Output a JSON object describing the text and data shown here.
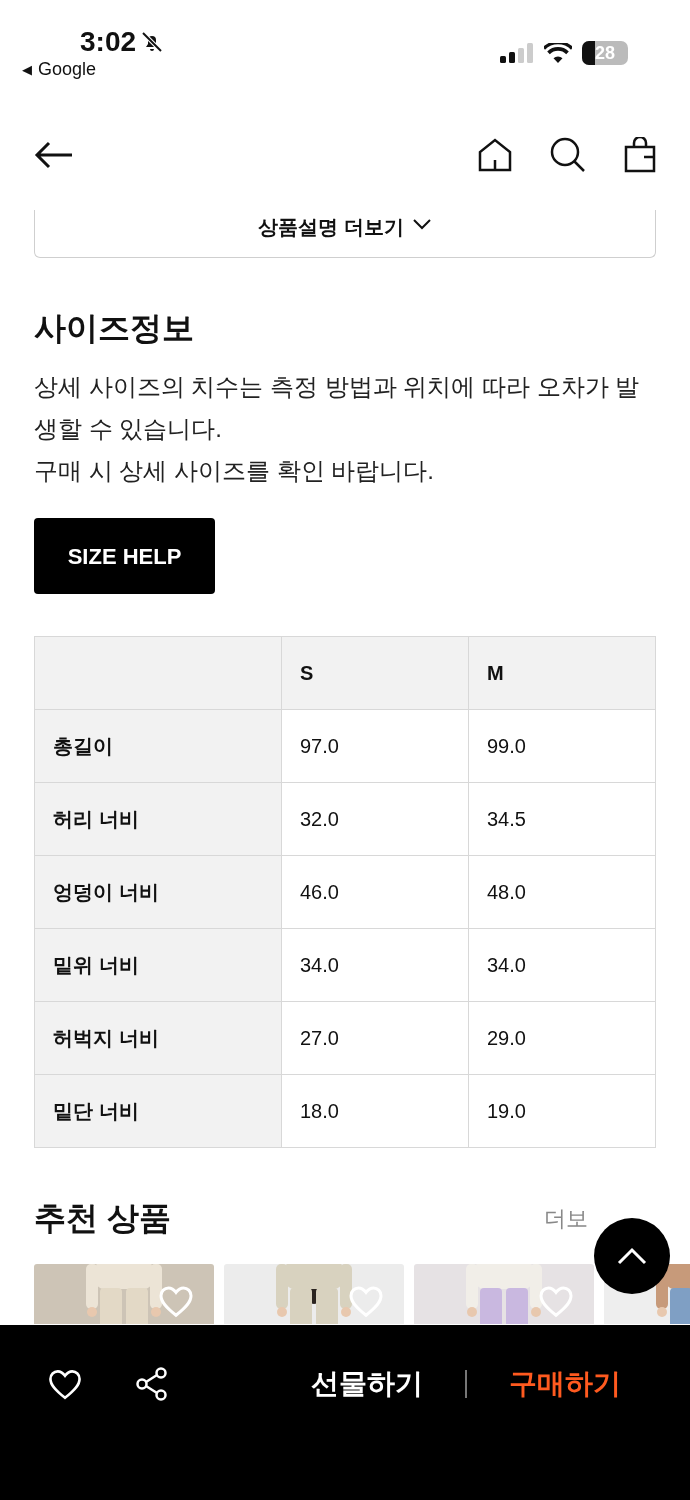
{
  "status_bar": {
    "time": "3:02",
    "back_app_arrow": "◀",
    "back_app": "Google",
    "battery": "28"
  },
  "description_toggle": {
    "label": "상품설명 더보기"
  },
  "size_info": {
    "title": "사이즈정보",
    "notes": [
      "상세 사이즈의 치수는 측정 방법과 위치에 따라 오차가 발생할 수 있습니다.",
      "구매 시 상세 사이즈를 확인 바랍니다."
    ],
    "help_button": "SIZE HELP"
  },
  "size_table": {
    "columns": [
      "S",
      "M"
    ],
    "rows": [
      {
        "label": "총길이",
        "values": [
          "97.0",
          "99.0"
        ]
      },
      {
        "label": "허리 너비",
        "values": [
          "32.0",
          "34.5"
        ]
      },
      {
        "label": "엉덩이 너비",
        "values": [
          "46.0",
          "48.0"
        ]
      },
      {
        "label": "밑위 너비",
        "values": [
          "34.0",
          "34.0"
        ]
      },
      {
        "label": "허벅지 너비",
        "values": [
          "27.0",
          "29.0"
        ]
      },
      {
        "label": "밑단 너비",
        "values": [
          "18.0",
          "19.0"
        ]
      }
    ]
  },
  "recommended": {
    "title": "추천 상품",
    "more": "더보"
  },
  "bottom_bar": {
    "gift": "선물하기",
    "buy": "구매하기"
  }
}
